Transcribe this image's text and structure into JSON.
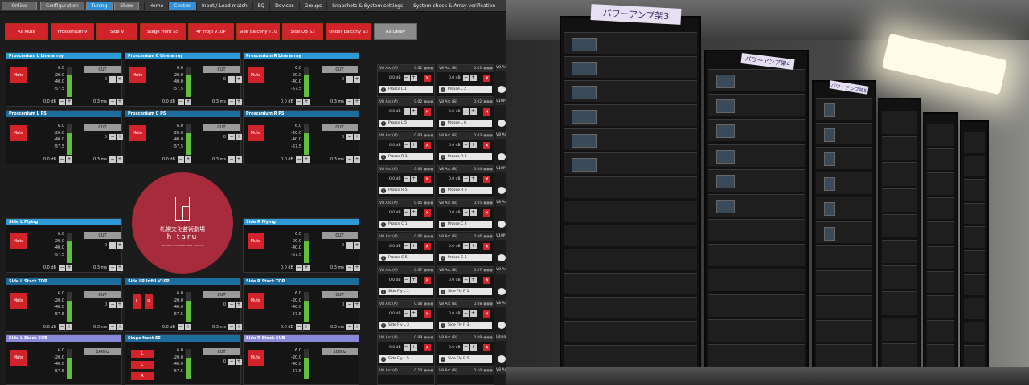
{
  "topbar": {
    "online": "Online",
    "modes": [
      "Configuration",
      "Tuning",
      "Show"
    ],
    "active_mode": "Tuning",
    "nav": [
      "Home",
      "Control",
      "Input / Load match",
      "EQ",
      "Devices",
      "Groups",
      "Snapshots & System settings",
      "System check & Array verification"
    ],
    "active_nav": "Control"
  },
  "group_buttons": [
    "All Mute",
    "Proscenium V",
    "Side V",
    "Stage front S5",
    "4F Hojo V10P",
    "Side balcony T10",
    "Side UB S3",
    "Under balcony S3",
    "All Delay"
  ],
  "panel_common": {
    "mute": "Mute",
    "cut": "CUT",
    "scale": [
      "6.0",
      "-20.0",
      "-40.0",
      "-57.5"
    ],
    "gain": "0.0 dB",
    "delay": "0.3 ms",
    "count": "0",
    "hpf": "100Hz",
    "minus": "−",
    "plus": "+",
    "L": "L",
    "R": "R",
    "C": "C"
  },
  "panels": [
    "Proscenium L Line array",
    "Proscenium C Line array",
    "Proscenium R Line array",
    "Proscenium L PS",
    "Proscenium C PS",
    "Proscenium R PS",
    "Side L Flying",
    "Side R Flying",
    "Side L Stack TOP",
    "Side LR Infill V10P",
    "Side R Stack TOP",
    "Side L Stack SUB",
    "Stage front S5",
    "Side R Stack SUB"
  ],
  "logo": {
    "jp": "札幌文化芸術劇場",
    "en": "hitaru",
    "sub": "SAPPORO CULTURAL ARTS THEATER"
  },
  "strips": {
    "gain": "0.0 dB",
    "col_a": [
      {
        "arc": "V8 Arc (A)",
        "num": "0.01",
        "name": "Prosce L 1"
      },
      {
        "arc": "V8 Arc (A)",
        "num": "0.02",
        "name": "Prosce L 5"
      },
      {
        "arc": "V8 Arc (A)",
        "num": "0.03",
        "name": "Prosce R 1"
      },
      {
        "arc": "V8 Arc (A)",
        "num": "0.04",
        "name": "Prosce R 5"
      },
      {
        "arc": "V8 Arc (A)",
        "num": "0.05",
        "name": "Prosce C 1"
      },
      {
        "arc": "V8 Arc (A)",
        "num": "0.06",
        "name": "Prosce C 5"
      },
      {
        "arc": "V8 Arc (A)",
        "num": "0.07",
        "name": "Side Fly L 1"
      },
      {
        "arc": "V8 Arc (A)",
        "num": "0.08",
        "name": "Side Fly L 3"
      },
      {
        "arc": "V8 Arc (A)",
        "num": "0.09",
        "name": "Side Fly L 5"
      },
      {
        "arc": "V8 Arc (A)",
        "num": "0.10",
        "name": ""
      }
    ],
    "col_b": [
      {
        "arc": "V8 Arc (B)",
        "num": "0.01",
        "name": "Prosce L 2"
      },
      {
        "arc": "V8 Arc (B)",
        "num": "0.02",
        "name": "Prosce L 6"
      },
      {
        "arc": "V8 Arc (B)",
        "num": "0.03",
        "name": "Prosce R 2"
      },
      {
        "arc": "V8 Arc (B)",
        "num": "0.04",
        "name": "Prosce R 6"
      },
      {
        "arc": "V8 Arc (B)",
        "num": "0.05",
        "name": "Prosce C 2"
      },
      {
        "arc": "V8 Arc (B)",
        "num": "0.06",
        "name": "Prosce C 6"
      },
      {
        "arc": "V8 Arc (B)",
        "num": "0.07",
        "name": "Side Fly R 1"
      },
      {
        "arc": "V8 Arc (B)",
        "num": "0.08",
        "name": "Side Fly R 3"
      },
      {
        "arc": "V8 Arc (B)",
        "num": "0.09",
        "name": "Side Fly R 5"
      },
      {
        "arc": "V8 Arc (B)",
        "num": "0.10",
        "name": ""
      }
    ],
    "col_c": [
      "V8 Ar",
      "V10P",
      "V8 Ar",
      "V10P",
      "V8 Ar",
      "V10P",
      "V8 Ar",
      "V8 Ar",
      "Linea",
      "V8 Ar"
    ]
  },
  "racks": {
    "label1": "パワーアンプ架3",
    "label2": "パワーアンプ架4",
    "label3": "パワーアンプ架5"
  }
}
